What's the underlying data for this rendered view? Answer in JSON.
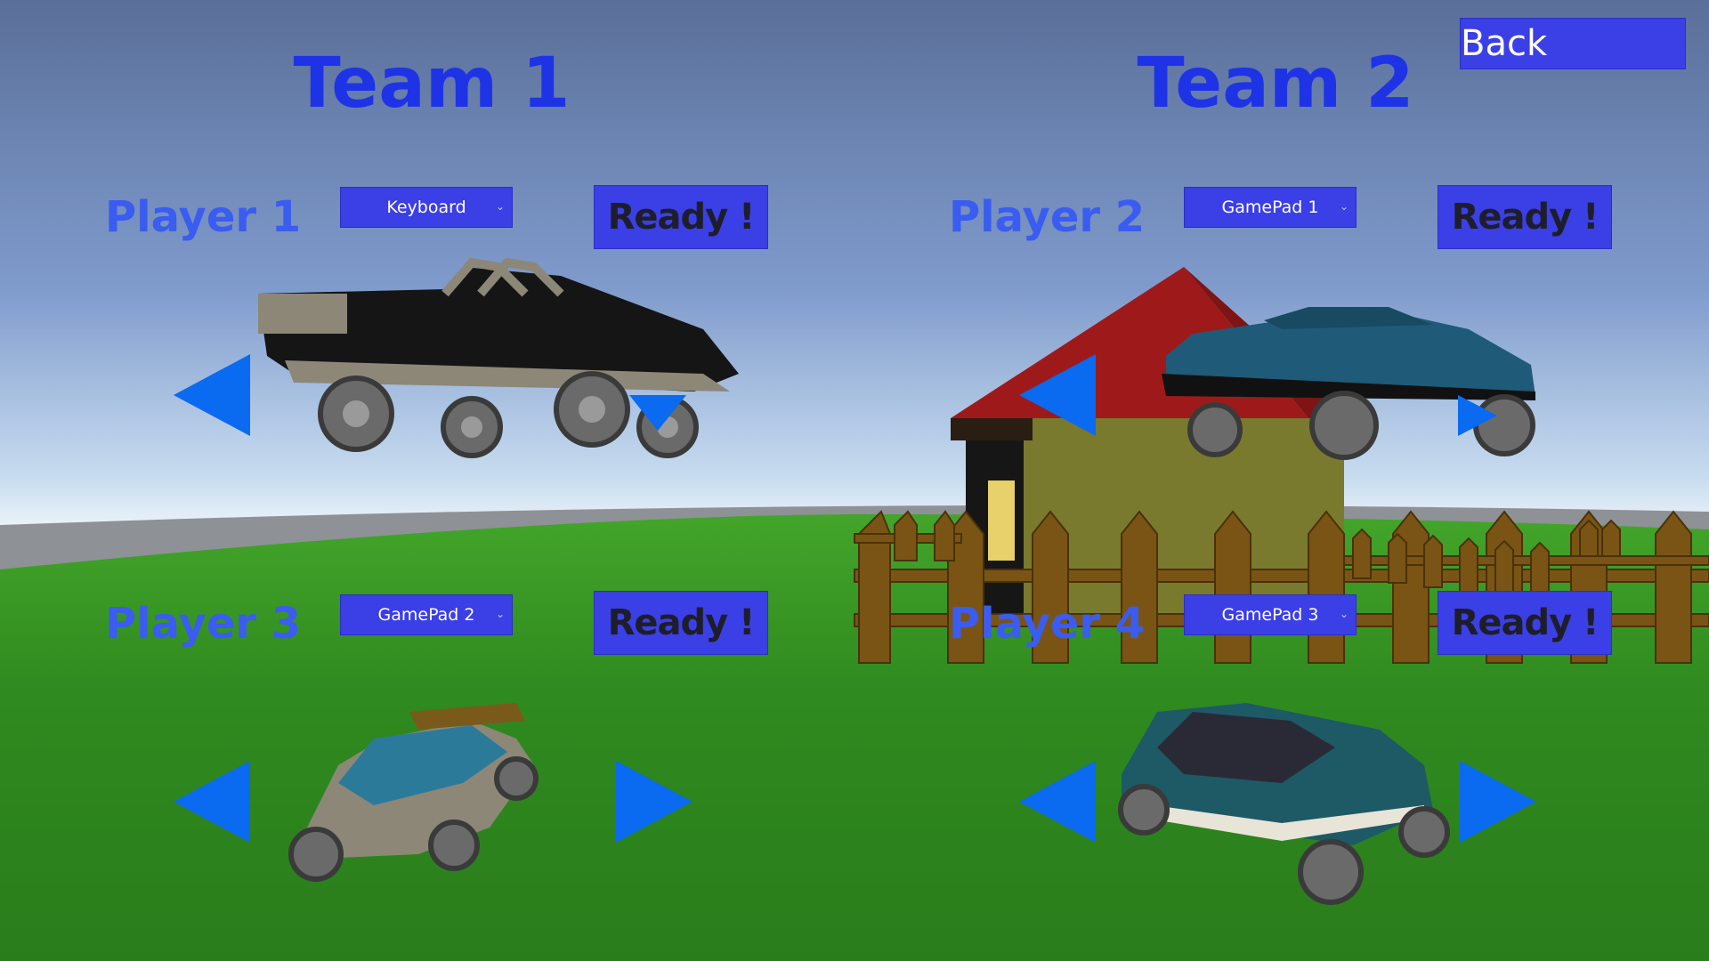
{
  "back_label": "Back",
  "teams": [
    {
      "title": "Team 1"
    },
    {
      "title": "Team 2"
    }
  ],
  "players": [
    {
      "label": "Player 1",
      "input": "Keyboard",
      "ready_label": "Ready !"
    },
    {
      "label": "Player 2",
      "input": "GamePad 1",
      "ready_label": "Ready !"
    },
    {
      "label": "Player 3",
      "input": "GamePad 2",
      "ready_label": "Ready !"
    },
    {
      "label": "Player 4",
      "input": "GamePad 3",
      "ready_label": "Ready !"
    }
  ],
  "icons": {
    "prev": "left-arrow-icon",
    "next": "right-arrow-icon",
    "dropdown": "chevron-down-icon"
  },
  "colors": {
    "title": "#1f33e6",
    "player_label": "#3a5cf0",
    "button": "#3b3fe6",
    "arrow": "#0a6af0",
    "grass": "#2f8a1f"
  }
}
